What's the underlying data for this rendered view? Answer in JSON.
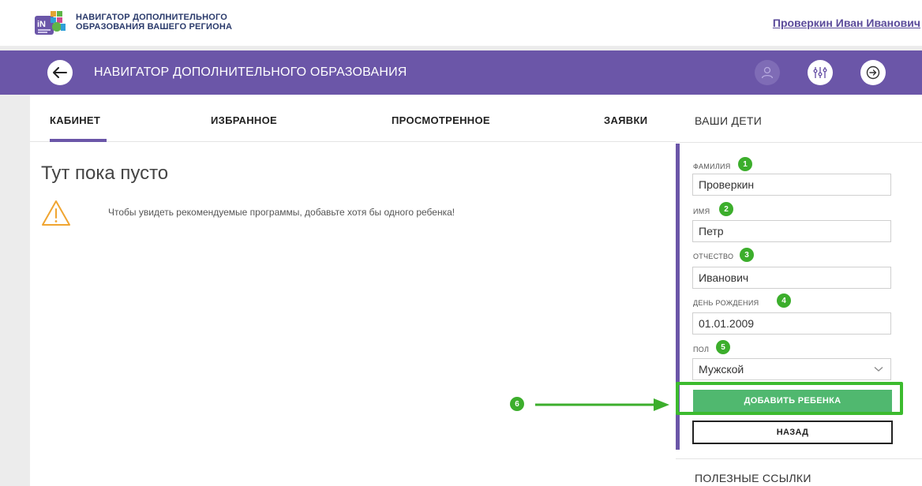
{
  "topbar": {
    "logo_line1": "НАВИГАТОР ДОПОЛНИТЕЛЬНОГО",
    "logo_line2": "ОБРАЗОВАНИЯ ВАШЕГО РЕГИОНА",
    "user_name": "Проверкин Иван Иванович"
  },
  "header": {
    "title": "НАВИГАТОР ДОПОЛНИТЕЛЬНОГО ОБРАЗОВАНИЯ"
  },
  "tabs": [
    {
      "label": "КАБИНЕТ",
      "active": true
    },
    {
      "label": "ИЗБРАННОЕ"
    },
    {
      "label": "ПРОСМОТРЕННОЕ"
    },
    {
      "label": "ЗАЯВКИ"
    }
  ],
  "main": {
    "empty_title": "Тут пока пусто",
    "warning_text": "Чтобы увидеть рекомендуемые программы, добавьте хотя бы одного ребенка!"
  },
  "right": {
    "heading": "ВАШИ ДЕТИ",
    "fields": [
      {
        "label": "ФАМИЛИЯ",
        "badge": "1",
        "value": "Проверкин"
      },
      {
        "label": "ИМЯ",
        "badge": "2",
        "value": "Петр"
      },
      {
        "label": "ОТЧЕСТВО",
        "badge": "3",
        "value": "Иванович"
      },
      {
        "label": "ДЕНЬ РОЖДЕНИЯ",
        "badge": "4",
        "value": "01.01.2009"
      },
      {
        "label": "ПОЛ",
        "badge": "5",
        "value": "Мужской"
      }
    ],
    "add_button": "ДОБАВИТЬ РЕБЕНКА",
    "back_button": "НАЗАД",
    "links_heading": "ПОЛЕЗНЫЕ ССЫЛКИ"
  },
  "annotation": {
    "step_badge": "6"
  },
  "colors": {
    "brand_purple": "#6b56a8",
    "badge_green": "#3cae2c",
    "button_green": "#50b86f"
  }
}
